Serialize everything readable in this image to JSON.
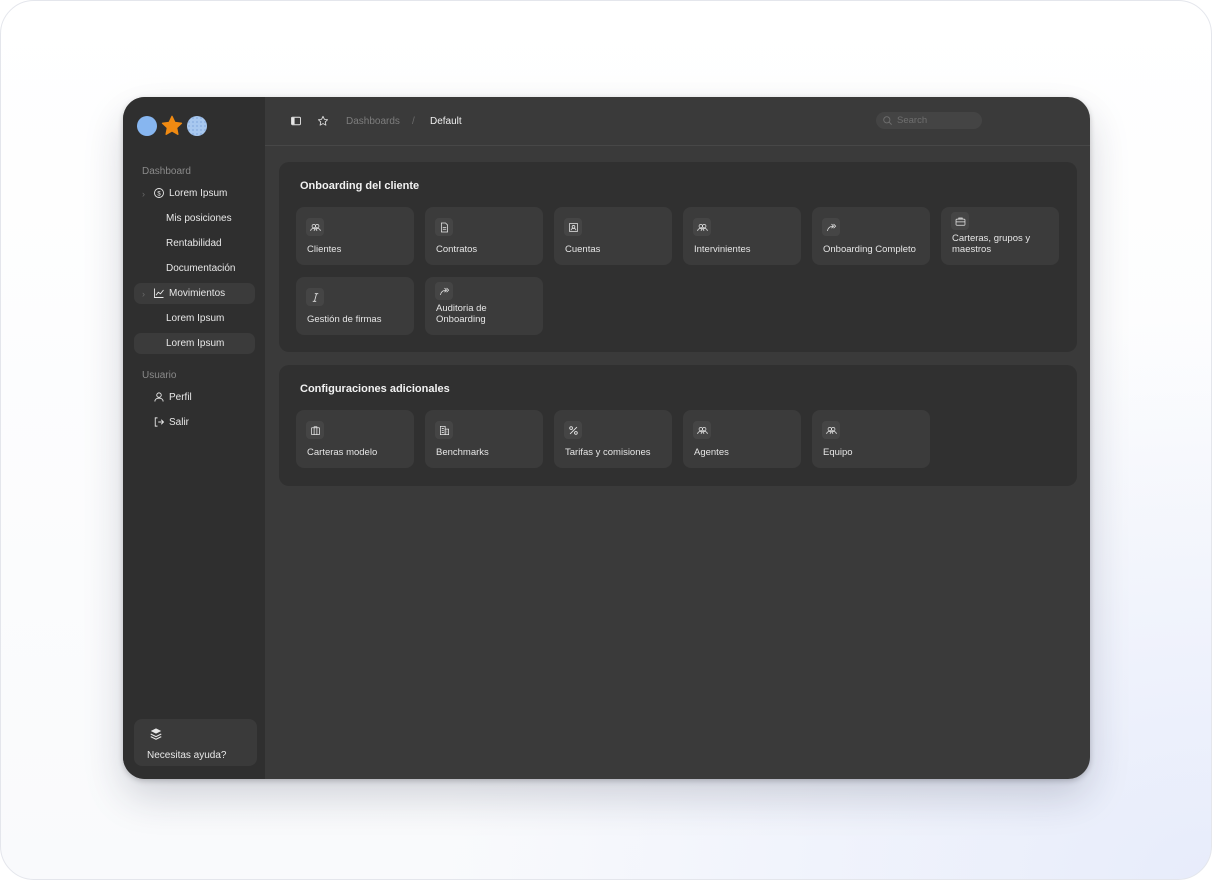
{
  "sidebar": {
    "section_dashboard": "Dashboard",
    "items": [
      {
        "label": "Lorem Ipsum",
        "icon": "dollar-circle-icon"
      },
      {
        "label": "Mis posiciones"
      },
      {
        "label": "Rentabilidad"
      },
      {
        "label": "Documentación"
      },
      {
        "label": "Movimientos",
        "icon": "chart-line-icon"
      },
      {
        "label": "Lorem Ipsum"
      },
      {
        "label": "Lorem Ipsum"
      }
    ],
    "section_user": "Usuario",
    "user_items": [
      {
        "label": "Perfil",
        "icon": "user-icon"
      },
      {
        "label": "Salir",
        "icon": "logout-icon"
      }
    ],
    "help": {
      "label": "Necesitas ayuda?",
      "icon": "layers-icon"
    }
  },
  "topbar": {
    "breadcrumb": [
      "Dashboards",
      "/",
      "Default"
    ],
    "search_placeholder": "Search",
    "icons": [
      "sidebar-toggle-icon",
      "star-icon",
      "sun-icon",
      "bell-icon",
      "panel-icon"
    ]
  },
  "sections": [
    {
      "title": "Onboarding del cliente",
      "tiles": [
        {
          "label": "Clientes",
          "icon": "users-icon"
        },
        {
          "label": "Contratos",
          "icon": "document-icon"
        },
        {
          "label": "Cuentas",
          "icon": "account-icon"
        },
        {
          "label": "Intervinientes",
          "icon": "users-icon"
        },
        {
          "label": "Onboarding Completo",
          "icon": "arrow-forward-icon"
        },
        {
          "label": "Carteras, grupos y maestros",
          "icon": "briefcase-icon"
        },
        {
          "label": "Gestión de firmas",
          "icon": "italic-icon"
        },
        {
          "label": "Auditoria de Onboarding",
          "icon": "arrow-forward-icon"
        }
      ]
    },
    {
      "title": "Configuraciones adicionales",
      "tiles": [
        {
          "label": "Carteras modelo",
          "icon": "portfolio-icon"
        },
        {
          "label": "Benchmarks",
          "icon": "building-icon"
        },
        {
          "label": "Tarifas y comisiones",
          "icon": "percent-icon"
        },
        {
          "label": "Agentes",
          "icon": "users-icon"
        },
        {
          "label": "Equipo",
          "icon": "users-icon"
        }
      ]
    }
  ]
}
